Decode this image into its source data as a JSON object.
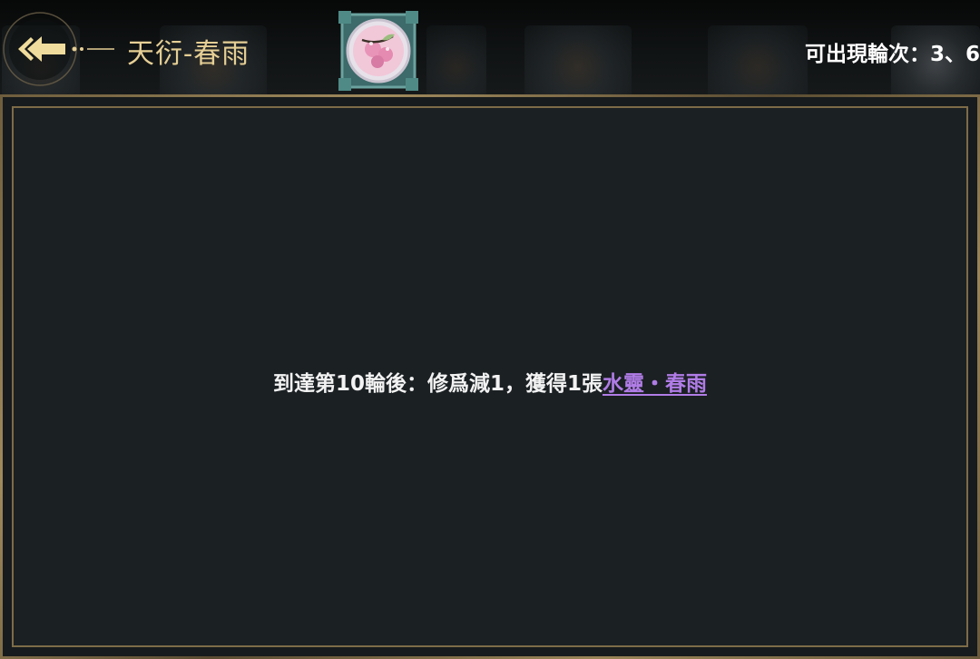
{
  "header": {
    "title": "天衍-春雨",
    "rounds_text": "可出現輪次：3、6"
  },
  "icons": {
    "back": "back-arrow-icon",
    "skill": "cherry-blossom-skill-icon"
  },
  "description": {
    "prefix": "到達第10輪後：修爲減1，獲得1張",
    "card_link": "水靈・春雨"
  },
  "colors": {
    "title_gold": "#e6cf95",
    "link_purple": "#b07ce6",
    "panel_bg": "#1b2023",
    "frame_gold": "#9a8558"
  }
}
